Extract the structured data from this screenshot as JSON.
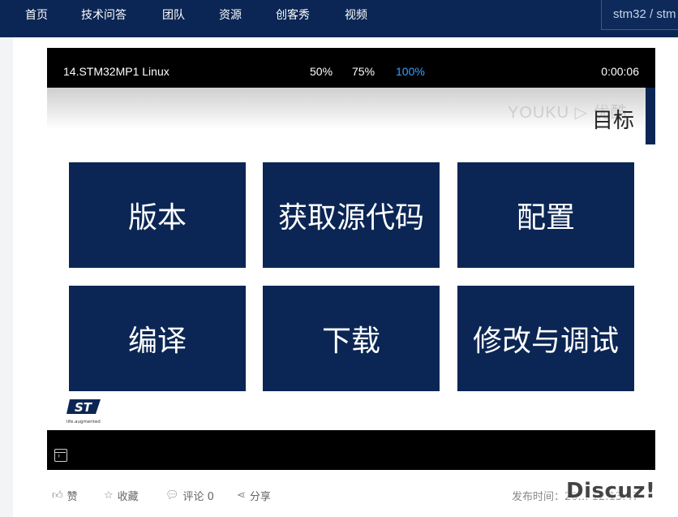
{
  "nav": {
    "items": [
      "首页",
      "技术问答",
      "团队",
      "资源",
      "创客秀",
      "视频"
    ],
    "search_value": "stm32 / stm"
  },
  "player": {
    "title": "14.STM32MP1 Linux",
    "qualities": [
      "50%",
      "75%",
      "100%"
    ],
    "active_quality": "100%",
    "time": "0:00:06"
  },
  "slide": {
    "watermark": "YOUKU ▷ 优酷",
    "title": "目标",
    "tiles": [
      "版本",
      "获取源代码",
      "配置",
      "编译",
      "下载",
      "修改与调试"
    ],
    "logo_tagline": "life.augmented"
  },
  "actions": {
    "like": "赞",
    "favorite": "收藏",
    "comment": "评论 0",
    "share": "分享",
    "publish_time": "发布时间：20… 12:13:47"
  },
  "watermark_brand": "Discuz!",
  "colors": {
    "nav_bg": "#0b2654",
    "tile_bg": "#0b2654",
    "active_quality": "#3aa0ff"
  }
}
